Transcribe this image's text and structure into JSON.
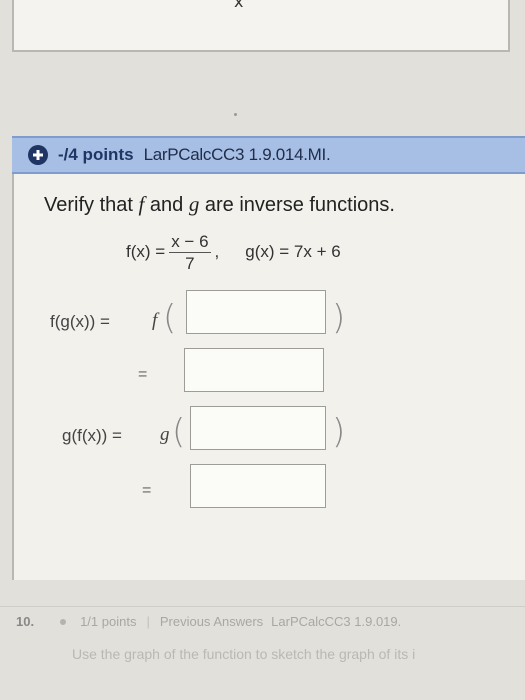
{
  "previous": {
    "close_glyph": "x"
  },
  "question": {
    "points": "-/4 points",
    "id": "LarPCalcCC3 1.9.014.MI.",
    "prompt_pre": "Verify that ",
    "prompt_f": "f",
    "prompt_mid": " and ",
    "prompt_g": "g",
    "prompt_post": " are inverse functions.",
    "f_label": "f(x) =",
    "f_num": "x − 6",
    "f_den": "7",
    "comma": ",",
    "g_def": "g(x) = 7x + 6",
    "row1_label": "f(g(x)) =",
    "row1_outer": "f",
    "row2_label": "=",
    "row3_label": "g(f(x)) =",
    "row3_outer": "g",
    "row4_label": "=",
    "open_paren": "(",
    "close_paren": ")"
  },
  "next_question": {
    "number": "10.",
    "points": "1/1 points",
    "separator": "|",
    "previous_answers": "Previous Answers",
    "id": "LarPCalcCC3 1.9.019.",
    "instruction": "Use the graph of the function to sketch the graph of its i"
  }
}
